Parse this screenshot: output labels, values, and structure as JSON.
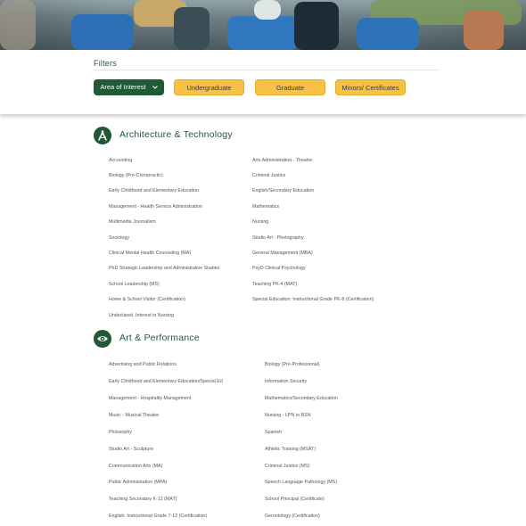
{
  "filters": {
    "title": "Filters",
    "buttons": [
      {
        "label": "Area of Interest",
        "icon": "chevron-down-icon"
      },
      {
        "label": "Undergraduate"
      },
      {
        "label": "Graduate"
      },
      {
        "label": "Minors/ Certificates"
      }
    ]
  },
  "colors": {
    "brand_green": "#1f5a35",
    "accent_gold": "#f7c244"
  },
  "sections": [
    {
      "title": "Architecture & Technology",
      "icon": "compass-icon",
      "left_column": [
        "Accounting",
        "Biology (Pre-Chiropractic)",
        "Early Childhood and Elementary Education",
        "Management - Health Service Administration",
        "Multimedia Journalism",
        "Sociology",
        "Clinical Mental Health Counseling (MA)",
        "PhD Strategic Leadership and Administrative Studies",
        "School Leadership (MS)",
        "Home & School Visitor (Certification)",
        "Undeclared, Interest in Nursing"
      ],
      "right_column": [
        "Arts Administration - Theatre",
        "Criminal Justice",
        "English/Secondary Education",
        "Mathematics",
        "Nursing",
        "Studio Art - Photography",
        "General Management (MBA)",
        "PsyD Clinical Psychology",
        "Teaching PK-4 (MAT)",
        "Special Education: Instructional Grade PK-8 (Certification)"
      ]
    },
    {
      "title": "Art & Performance",
      "icon": "eye-icon",
      "left_column": [
        "Advertising and Public Relations",
        "Early Childhood and Elementary Education/Special Ed",
        "Management - Hospitality Management",
        "Music - Musical Theatre",
        "Philosophy",
        "Studio Art - Sculpture",
        "Communication Arts (MA)",
        "Public Administration (MPA)",
        "Teaching Secondary K-12 (MAT)",
        "English: Instructional Grade 7-12 (Certification)"
      ],
      "right_column": [
        "Biology (Pre-Professional)",
        "Information Security",
        "Mathematics/Secondary Education",
        "Nursing - LPN to BSN",
        "Spanish",
        "Athletic Training (MSAT)",
        "Criminal Justice (MS)",
        "Speech Language Pathology (MS)",
        "School Principal (Certificate)",
        "Gerontology (Certification)"
      ]
    }
  ]
}
